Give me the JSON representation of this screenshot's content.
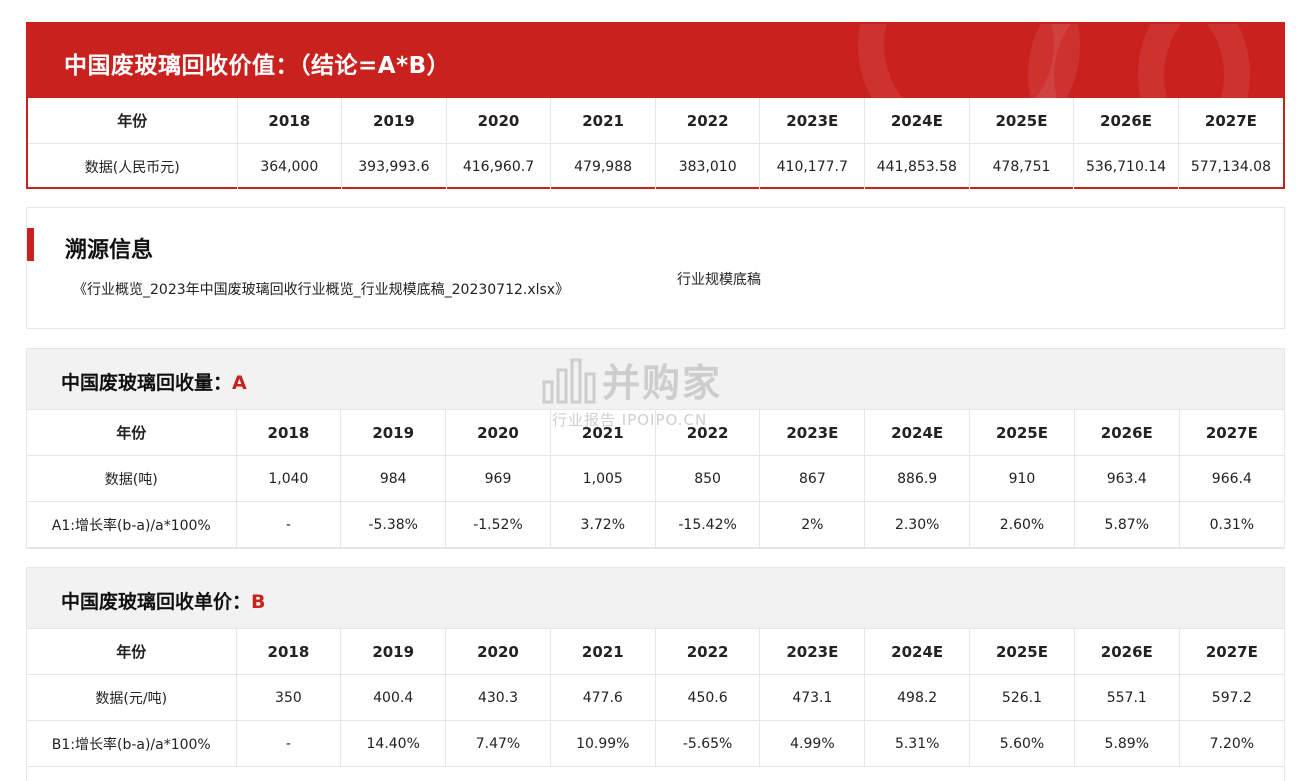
{
  "value_section": {
    "title": "中国废玻璃回收价值：（结论=A*B）",
    "years": [
      "年份",
      "2018",
      "2019",
      "2020",
      "2021",
      "2022",
      "2023E",
      "2024E",
      "2025E",
      "2026E",
      "2027E"
    ],
    "row": [
      "数据(人民币元)",
      "364,000",
      "393,993.6",
      "416,960.7",
      "479,988",
      "383,010",
      "410,177.7",
      "441,853.58",
      "478,751",
      "536,710.14",
      "577,134.08"
    ]
  },
  "source_section": {
    "title": "溯源信息",
    "file": "《行业概览_2023年中国废玻璃回收行业概览_行业规模底稿_20230712.xlsx》",
    "sheet": "行业规模底稿"
  },
  "volume_section": {
    "title": "中国废玻璃回收量：",
    "key": "A",
    "years": [
      "年份",
      "2018",
      "2019",
      "2020",
      "2021",
      "2022",
      "2023E",
      "2024E",
      "2025E",
      "2026E",
      "2027E"
    ],
    "data_row": [
      "数据(吨)",
      "1,040",
      "984",
      "969",
      "1,005",
      "850",
      "867",
      "886.9",
      "910",
      "963.4",
      "966.4"
    ],
    "growth_row": [
      "A1:增长率(b-a)/a*100%",
      "-",
      "-5.38%",
      "-1.52%",
      "3.72%",
      "-15.42%",
      "2%",
      "2.30%",
      "2.60%",
      "5.87%",
      "0.31%"
    ]
  },
  "price_section": {
    "title": "中国废玻璃回收单价：",
    "key": "B",
    "years": [
      "年份",
      "2018",
      "2019",
      "2020",
      "2021",
      "2022",
      "2023E",
      "2024E",
      "2025E",
      "2026E",
      "2027E"
    ],
    "data_row": [
      "数据(元/吨)",
      "350",
      "400.4",
      "430.3",
      "477.6",
      "450.6",
      "473.1",
      "498.2",
      "526.1",
      "557.1",
      "597.2"
    ],
    "growth_row": [
      "B1:增长率(b-a)/a*100%",
      "-",
      "14.40%",
      "7.47%",
      "10.99%",
      "-5.65%",
      "4.99%",
      "5.31%",
      "5.60%",
      "5.89%",
      "7.20%"
    ]
  },
  "watermark": {
    "brand": "并购家",
    "sub": "行业报告 IPOIPO.CN"
  },
  "colors": {
    "accent": "#c9211e",
    "section_bg": "#f2f2f2",
    "border": "#e6e6e6"
  }
}
